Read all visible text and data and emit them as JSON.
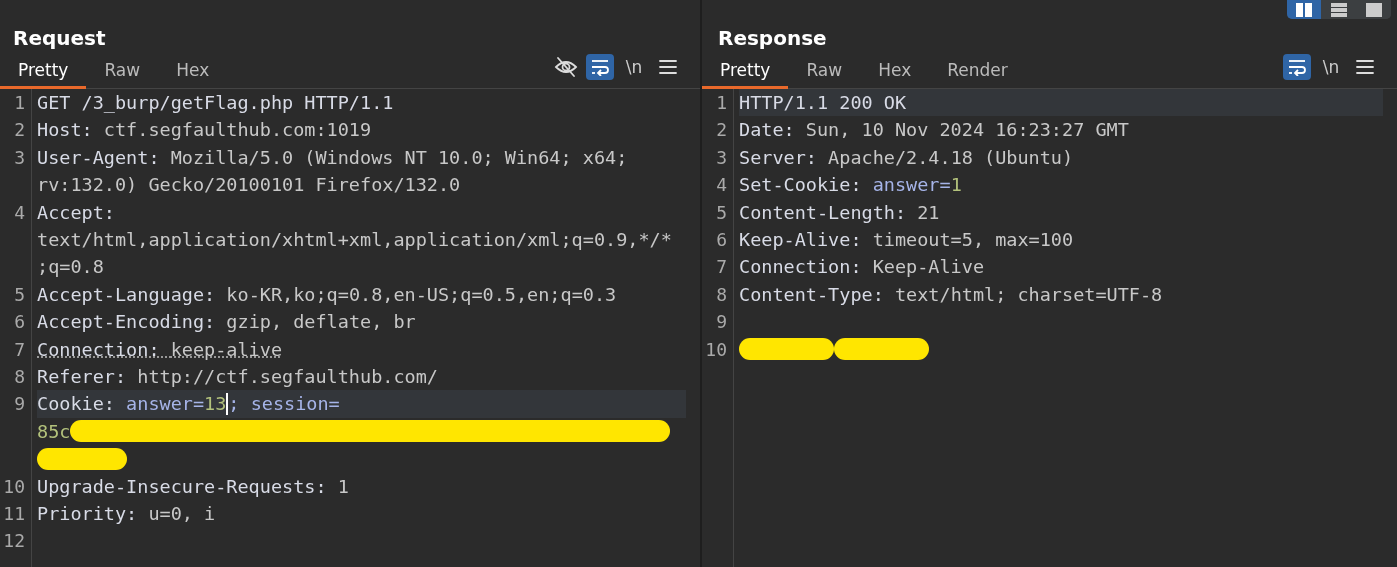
{
  "layout_buttons": [
    {
      "kind": "columns",
      "selected": true
    },
    {
      "kind": "rows",
      "selected": false
    },
    {
      "kind": "single",
      "selected": false
    }
  ],
  "panels": [
    {
      "title": "Request",
      "tabs": [
        {
          "label": "Pretty",
          "selected": true
        },
        {
          "label": "Raw",
          "selected": false
        },
        {
          "label": "Hex",
          "selected": false
        }
      ],
      "tools": [
        {
          "kind": "hide",
          "selected": false
        },
        {
          "kind": "wrap",
          "selected": true
        },
        {
          "kind": "newline",
          "label": "\\n",
          "selected": false
        },
        {
          "kind": "menu",
          "selected": false
        }
      ],
      "lines": [
        {
          "number": "1",
          "current": false,
          "flagged": false,
          "rows": [
            [
              {
                "kind": "name",
                "text": "GET /3_burp/getFlag.php HTTP/1.1"
              }
            ]
          ]
        },
        {
          "number": "2",
          "current": false,
          "flagged": false,
          "rows": [
            [
              {
                "kind": "name",
                "text": "Host: "
              },
              {
                "kind": "value",
                "text": "ctf.segfaulthub.com:1019"
              }
            ]
          ]
        },
        {
          "number": "3",
          "current": false,
          "flagged": false,
          "rows": [
            [
              {
                "kind": "name",
                "text": "User-Agent: "
              },
              {
                "kind": "value",
                "text": "Mozilla/5.0 (Windows NT 10.0; Win64; x64;"
              }
            ],
            [
              {
                "kind": "value",
                "text": "rv:132.0) Gecko/20100101 Firefox/132.0"
              }
            ]
          ]
        },
        {
          "number": "4",
          "current": false,
          "flagged": false,
          "rows": [
            [
              {
                "kind": "name",
                "text": "Accept: "
              }
            ],
            [
              {
                "kind": "value",
                "text": "text/html,application/xhtml+xml,application/xml;q=0.9,*/*"
              }
            ],
            [
              {
                "kind": "value",
                "text": ";q=0.8"
              }
            ]
          ]
        },
        {
          "number": "5",
          "current": false,
          "flagged": false,
          "rows": [
            [
              {
                "kind": "name",
                "text": "Accept-Language: "
              },
              {
                "kind": "value",
                "text": "ko-KR,ko;q=0.8,en-US;q=0.5,en;q=0.3"
              }
            ]
          ]
        },
        {
          "number": "6",
          "current": false,
          "flagged": false,
          "rows": [
            [
              {
                "kind": "name",
                "text": "Accept-Encoding: "
              },
              {
                "kind": "value",
                "text": "gzip, deflate, br"
              }
            ]
          ]
        },
        {
          "number": "7",
          "current": false,
          "flagged": true,
          "rows": [
            [
              {
                "kind": "name",
                "text": "Connection: "
              },
              {
                "kind": "value",
                "text": "keep-alive"
              }
            ]
          ]
        },
        {
          "number": "8",
          "current": false,
          "flagged": false,
          "rows": [
            [
              {
                "kind": "name",
                "text": "Referer: "
              },
              {
                "kind": "value",
                "text": "http://ctf.segfaulthub.com/"
              }
            ]
          ]
        },
        {
          "number": "9",
          "current": true,
          "flagged": false,
          "rows": [
            [
              {
                "kind": "name",
                "text": "Cookie: "
              },
              {
                "kind": "param",
                "text": "answer="
              },
              {
                "kind": "param-value",
                "text": "13"
              },
              {
                "kind": "cursor"
              },
              {
                "kind": "param",
                "text": "; session="
              }
            ],
            [
              {
                "kind": "param-value",
                "text": "85c"
              },
              {
                "kind": "redaction"
              }
            ],
            [
              {
                "kind": "redaction"
              }
            ]
          ]
        },
        {
          "number": "10",
          "current": false,
          "flagged": false,
          "rows": [
            [
              {
                "kind": "name",
                "text": "Upgrade-Insecure-Requests: "
              },
              {
                "kind": "value",
                "text": "1"
              }
            ]
          ]
        },
        {
          "number": "11",
          "current": false,
          "flagged": false,
          "rows": [
            [
              {
                "kind": "name",
                "text": "Priority: "
              },
              {
                "kind": "value",
                "text": "u=0, i"
              }
            ]
          ]
        },
        {
          "number": "12",
          "current": false,
          "flagged": false,
          "rows": [
            []
          ]
        }
      ]
    },
    {
      "title": "Response",
      "tabs": [
        {
          "label": "Pretty",
          "selected": true
        },
        {
          "label": "Raw",
          "selected": false
        },
        {
          "label": "Hex",
          "selected": false
        },
        {
          "label": "Render",
          "selected": false
        }
      ],
      "tools": [
        {
          "kind": "wrap",
          "selected": true
        },
        {
          "kind": "newline",
          "label": "\\n",
          "selected": false
        },
        {
          "kind": "menu",
          "selected": false
        }
      ],
      "lines": [
        {
          "number": "1",
          "current": true,
          "flagged": false,
          "rows": [
            [
              {
                "kind": "name",
                "text": "HTTP/1.1 200 OK"
              }
            ]
          ]
        },
        {
          "number": "2",
          "current": false,
          "flagged": false,
          "rows": [
            [
              {
                "kind": "name",
                "text": "Date: "
              },
              {
                "kind": "value",
                "text": "Sun, 10 Nov 2024 16:23:27 GMT"
              }
            ]
          ]
        },
        {
          "number": "3",
          "current": false,
          "flagged": false,
          "rows": [
            [
              {
                "kind": "name",
                "text": "Server: "
              },
              {
                "kind": "value",
                "text": "Apache/2.4.18 (Ubuntu)"
              }
            ]
          ]
        },
        {
          "number": "4",
          "current": false,
          "flagged": false,
          "rows": [
            [
              {
                "kind": "name",
                "text": "Set-Cookie: "
              },
              {
                "kind": "param",
                "text": "answer="
              },
              {
                "kind": "param-value",
                "text": "1"
              }
            ]
          ]
        },
        {
          "number": "5",
          "current": false,
          "flagged": false,
          "rows": [
            [
              {
                "kind": "name",
                "text": "Content-Length: "
              },
              {
                "kind": "value",
                "text": "21"
              }
            ]
          ]
        },
        {
          "number": "6",
          "current": false,
          "flagged": false,
          "rows": [
            [
              {
                "kind": "name",
                "text": "Keep-Alive: "
              },
              {
                "kind": "value",
                "text": "timeout=5, max=100"
              }
            ]
          ]
        },
        {
          "number": "7",
          "current": false,
          "flagged": false,
          "rows": [
            [
              {
                "kind": "name",
                "text": "Connection: "
              },
              {
                "kind": "value",
                "text": "Keep-Alive"
              }
            ]
          ]
        },
        {
          "number": "8",
          "current": false,
          "flagged": false,
          "rows": [
            [
              {
                "kind": "name",
                "text": "Content-Type: "
              },
              {
                "kind": "value",
                "text": "text/html; charset=UTF-8"
              }
            ]
          ]
        },
        {
          "number": "9",
          "current": false,
          "flagged": false,
          "rows": [
            []
          ]
        },
        {
          "number": "10",
          "current": false,
          "flagged": false,
          "rows": [
            [
              {
                "kind": "redaction"
              },
              {
                "kind": "redaction"
              }
            ]
          ]
        }
      ]
    }
  ]
}
